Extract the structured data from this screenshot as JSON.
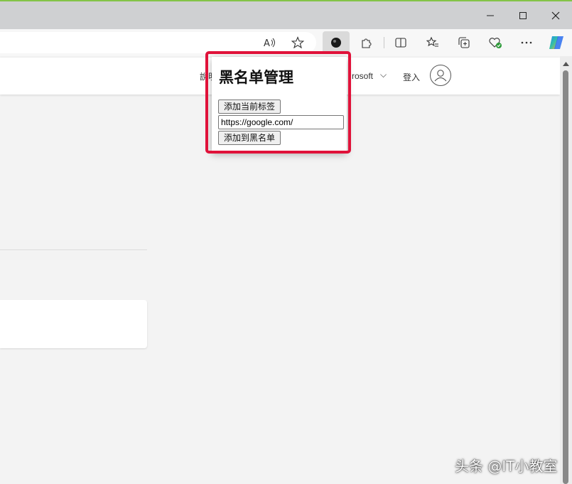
{
  "window_controls": {
    "minimize": "minimize",
    "maximize": "maximize",
    "close": "close"
  },
  "toolbar_icons": [
    "read-aloud-icon",
    "favorite-star-icon",
    "extension-active-icon",
    "extensions-puzzle-icon",
    "split-screen-icon",
    "favorites-icon",
    "collections-icon",
    "browser-essentials-icon",
    "more-icon",
    "copilot-icon"
  ],
  "header": {
    "left_partial": "說明",
    "microsoft_partial": "rosoft",
    "chevron": "⌵",
    "signin": "登入"
  },
  "popup": {
    "title": "黑名单管理",
    "add_current_tab_label": "添加当前标签",
    "url_value": "https://google.com/",
    "add_to_blacklist_label": "添加到黑名单"
  },
  "watermark": "头条 @IT小教室",
  "colors": {
    "highlight": "#e0123a",
    "accent_top": "#84c447"
  }
}
